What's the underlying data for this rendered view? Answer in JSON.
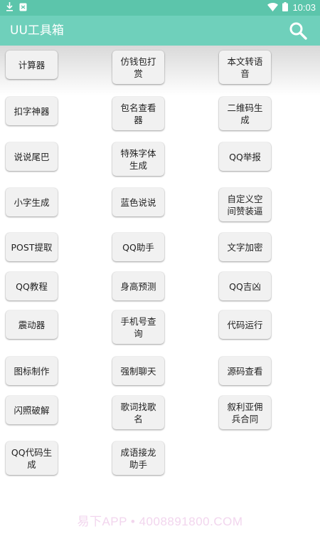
{
  "status_bar": {
    "time": "10:03",
    "icons": [
      "download-icon",
      "notification-icon",
      "wifi-icon",
      "battery-icon"
    ]
  },
  "app_bar": {
    "title": "UU工具箱",
    "search_icon": "search-icon",
    "color": "#6fd0bb"
  },
  "tools": [
    "计算器",
    "仿钱包打赏",
    "本文转语音",
    "扣字神器",
    "包名查看器",
    "二维码生成",
    "说说尾巴",
    "特殊字体生成",
    "QQ举报",
    "小字生成",
    "蓝色说说",
    "自定义空间赞装逼",
    "POST提取",
    "QQ助手",
    "文字加密",
    "QQ教程",
    "身高预测",
    "QQ吉凶",
    "震动器",
    "手机号查询",
    "代码运行",
    "图标制作",
    "强制聊天",
    "源码查看",
    "闪照破解",
    "歌词找歌名",
    "叙利亚佣兵合同",
    "QQ代码生成",
    "成语接龙助手"
  ],
  "watermark": "易下APP • 4008891800.COM"
}
